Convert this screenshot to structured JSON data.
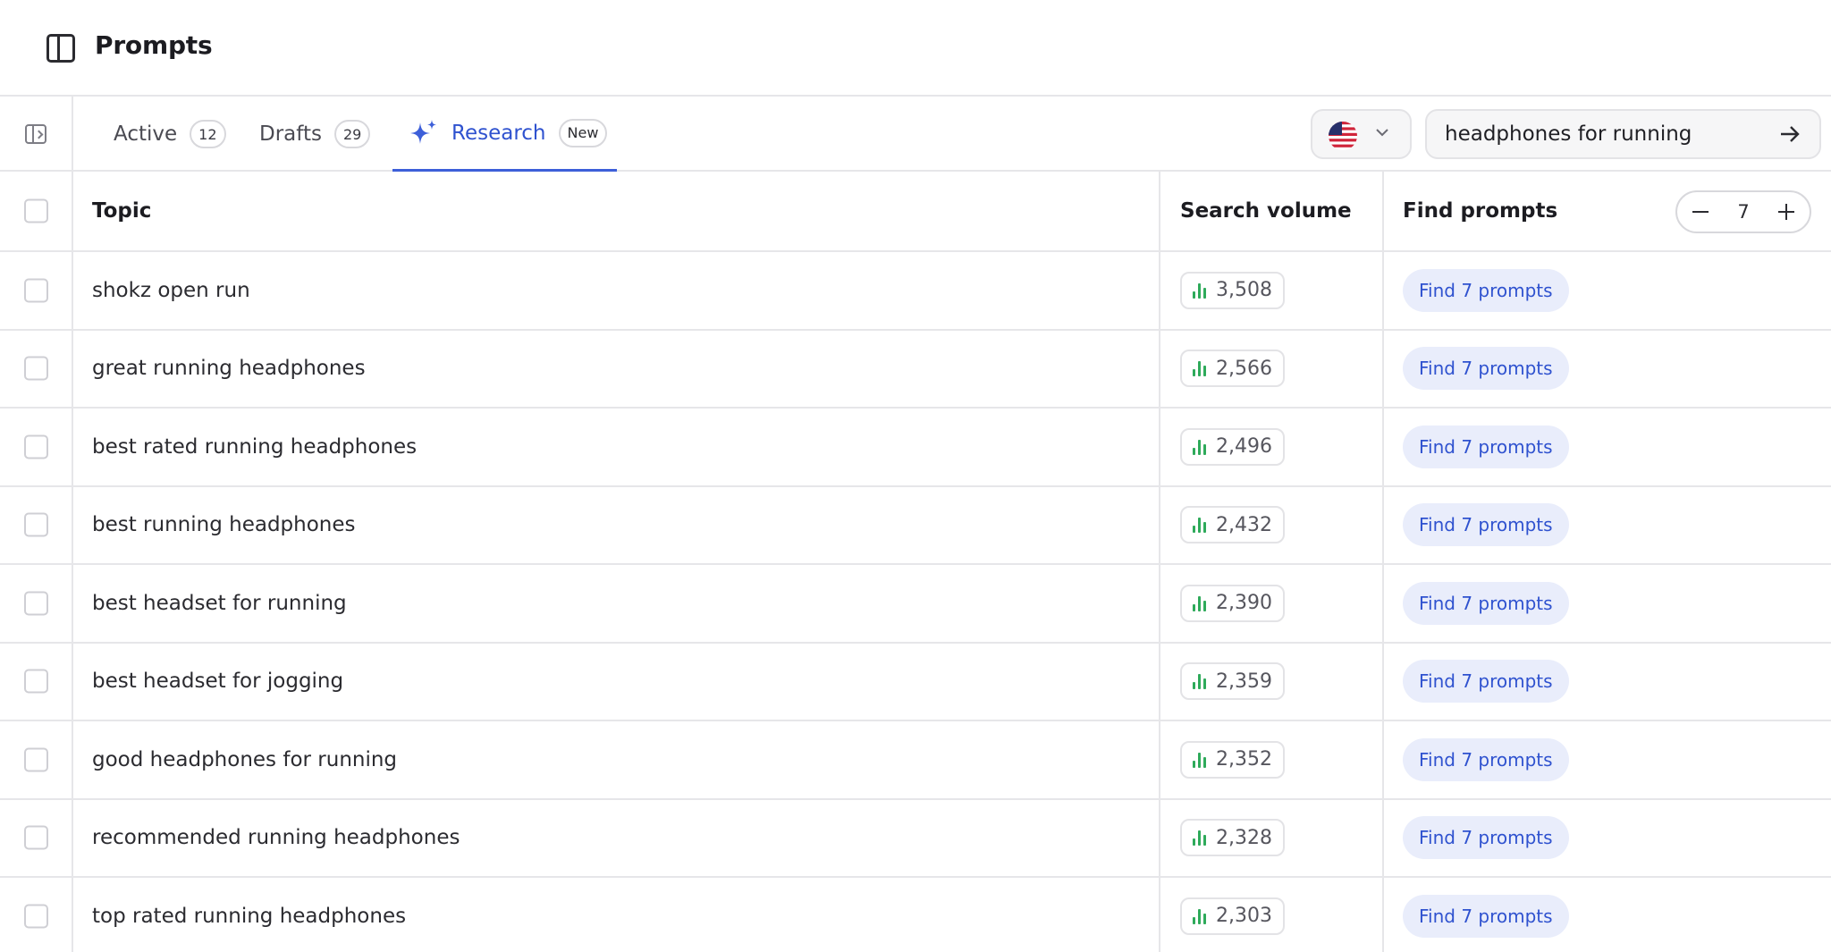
{
  "header": {
    "title": "Prompts",
    "panel_icon": "sidebar-panel-icon"
  },
  "tabs": [
    {
      "label": "Active",
      "count": "12"
    },
    {
      "label": "Drafts",
      "count": "29"
    },
    {
      "label": "Research",
      "badge": "New",
      "icon": "sparkle-icon"
    }
  ],
  "country": {
    "flag": "us-flag",
    "chevron": "chevron-down-icon"
  },
  "search": {
    "value": "headphones for running",
    "go_icon": "arrow-right-icon"
  },
  "table": {
    "columns": {
      "topic": "Topic",
      "volume": "Search volume",
      "find": "Find prompts"
    },
    "stepper": {
      "value": "7"
    },
    "rows": [
      {
        "topic": "shokz open run",
        "volume": "3,508",
        "action": "Find 7 prompts"
      },
      {
        "topic": "great running headphones",
        "volume": "2,566",
        "action": "Find 7 prompts"
      },
      {
        "topic": "best rated running headphones",
        "volume": "2,496",
        "action": "Find 7 prompts"
      },
      {
        "topic": "best running headphones",
        "volume": "2,432",
        "action": "Find 7 prompts"
      },
      {
        "topic": "best headset for running",
        "volume": "2,390",
        "action": "Find 7 prompts"
      },
      {
        "topic": "best headset for jogging",
        "volume": "2,359",
        "action": "Find 7 prompts"
      },
      {
        "topic": "good headphones for running",
        "volume": "2,352",
        "action": "Find 7 prompts"
      },
      {
        "topic": "recommended running headphones",
        "volume": "2,328",
        "action": "Find 7 prompts"
      },
      {
        "topic": "top rated running headphones",
        "volume": "2,303",
        "action": "Find 7 prompts"
      }
    ]
  },
  "colors": {
    "accent": "#2f52cf",
    "accent_bg": "#e9edfb",
    "bar_green": "#2eaa5a",
    "border": "#e6e6e9"
  }
}
